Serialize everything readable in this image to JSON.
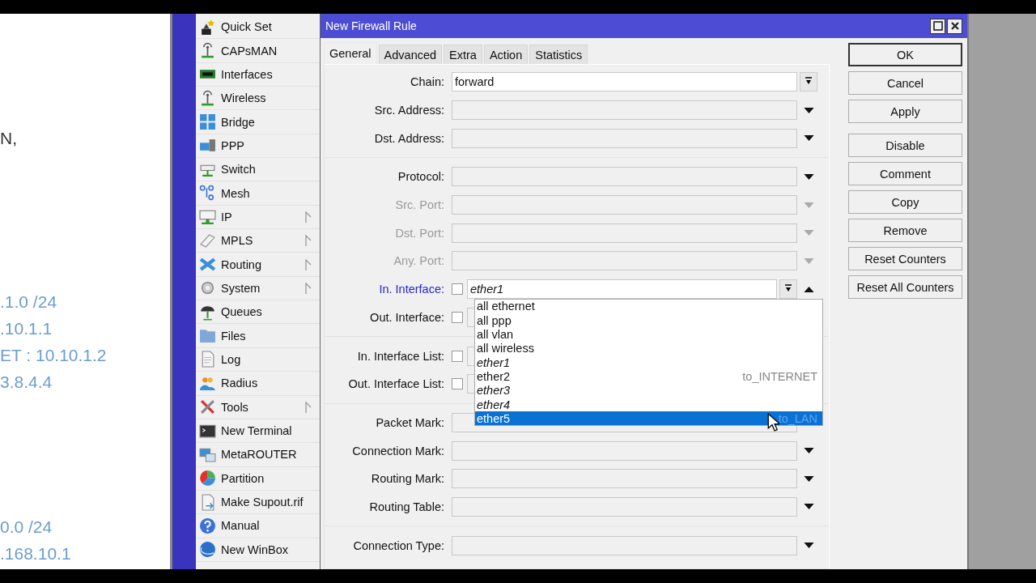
{
  "slide": {
    "blocks": [
      {
        "color": "#333333",
        "lines": [
          "N,"
        ]
      },
      {
        "color": "#6b9dcf",
        "lines": [
          ".1.0 /24",
          ".10.1.1",
          "ET : 10.10.1.2",
          "3.8.4.4"
        ]
      },
      {
        "color": "#6b9dcf",
        "lines": [
          "0.0 /24",
          ".168.10.1"
        ]
      }
    ]
  },
  "menu": {
    "items": [
      {
        "label": "Quick Set",
        "submenu": false
      },
      {
        "label": "CAPsMAN",
        "submenu": false
      },
      {
        "label": "Interfaces",
        "submenu": false
      },
      {
        "label": "Wireless",
        "submenu": false
      },
      {
        "label": "Bridge",
        "submenu": false
      },
      {
        "label": "PPP",
        "submenu": false
      },
      {
        "label": "Switch",
        "submenu": false
      },
      {
        "label": "Mesh",
        "submenu": false
      },
      {
        "label": "IP",
        "submenu": true
      },
      {
        "label": "MPLS",
        "submenu": true
      },
      {
        "label": "Routing",
        "submenu": true
      },
      {
        "label": "System",
        "submenu": true
      },
      {
        "label": "Queues",
        "submenu": false
      },
      {
        "label": "Files",
        "submenu": false
      },
      {
        "label": "Log",
        "submenu": false
      },
      {
        "label": "Radius",
        "submenu": false
      },
      {
        "label": "Tools",
        "submenu": true
      },
      {
        "label": "New Terminal",
        "submenu": false
      },
      {
        "label": "MetaROUTER",
        "submenu": false
      },
      {
        "label": "Partition",
        "submenu": false
      },
      {
        "label": "Make Supout.rif",
        "submenu": false
      },
      {
        "label": "Manual",
        "submenu": false
      },
      {
        "label": "New WinBox",
        "submenu": false
      }
    ]
  },
  "dialog": {
    "title": "New Firewall Rule",
    "tabs": [
      {
        "label": "General",
        "selected": true
      },
      {
        "label": "Advanced",
        "selected": false
      },
      {
        "label": "Extra",
        "selected": false
      },
      {
        "label": "Action",
        "selected": false
      },
      {
        "label": "Statistics",
        "selected": false
      }
    ],
    "sections": [
      {
        "rows": [
          {
            "label": "Chain:",
            "kind": "select",
            "value": "forward",
            "disabled": false
          },
          {
            "label": "Src. Address:",
            "kind": "combo",
            "disabled": false
          },
          {
            "label": "Dst. Address:",
            "kind": "combo",
            "disabled": false
          }
        ]
      },
      {
        "rows": [
          {
            "label": "Protocol:",
            "kind": "combo",
            "disabled": false
          },
          {
            "label": "Src. Port:",
            "kind": "combo",
            "disabled": true
          },
          {
            "label": "Dst. Port:",
            "kind": "combo",
            "disabled": true
          },
          {
            "label": "Any. Port:",
            "kind": "combo",
            "disabled": true
          },
          {
            "label": "In. Interface:",
            "kind": "interface",
            "disabled": false,
            "focused": true,
            "checked": false,
            "value": "ether1",
            "open": true
          },
          {
            "label": "Out. Interface:",
            "kind": "interface",
            "disabled": false,
            "focused": false,
            "checked": false,
            "open": false
          }
        ]
      },
      {
        "rows": [
          {
            "label": "In. Interface List:",
            "kind": "interface",
            "disabled": false,
            "focused": false,
            "checked": false,
            "open": false
          },
          {
            "label": "Out. Interface List:",
            "kind": "interface",
            "disabled": false,
            "focused": false,
            "checked": false,
            "open": false
          }
        ]
      },
      {
        "rows": [
          {
            "label": "Packet Mark:",
            "kind": "combo",
            "disabled": false,
            "covered": true
          },
          {
            "label": "Connection Mark:",
            "kind": "combo",
            "disabled": false
          },
          {
            "label": "Routing Mark:",
            "kind": "combo",
            "disabled": false
          },
          {
            "label": "Routing Table:",
            "kind": "combo",
            "disabled": false
          }
        ]
      },
      {
        "rows": [
          {
            "label": "Connection Type:",
            "kind": "combo",
            "disabled": false
          }
        ]
      }
    ],
    "dropdown": {
      "items": [
        {
          "label": "all ethernet",
          "inactive": false,
          "selected": false
        },
        {
          "label": "all ppp",
          "inactive": false,
          "selected": false
        },
        {
          "label": "all vlan",
          "inactive": false,
          "selected": false
        },
        {
          "label": "all wireless",
          "inactive": false,
          "selected": false
        },
        {
          "label": "ether1",
          "inactive": true,
          "selected": false
        },
        {
          "label": "ether2",
          "inactive": false,
          "selected": false,
          "note": "to_INTERNET"
        },
        {
          "label": "ether3",
          "inactive": true,
          "selected": false
        },
        {
          "label": "ether4",
          "inactive": true,
          "selected": false
        },
        {
          "label": "ether5",
          "inactive": false,
          "selected": true,
          "note": "to_LAN"
        }
      ]
    },
    "button_groups": [
      [
        {
          "label": "OK",
          "default": true
        },
        {
          "label": "Cancel",
          "default": false
        },
        {
          "label": "Apply",
          "default": false
        }
      ],
      [
        {
          "label": "Disable",
          "default": false
        },
        {
          "label": "Comment",
          "default": false
        },
        {
          "label": "Copy",
          "default": false
        },
        {
          "label": "Remove",
          "default": false
        },
        {
          "label": "Reset Counters",
          "default": false
        },
        {
          "label": "Reset All Counters",
          "default": false
        }
      ]
    ]
  }
}
